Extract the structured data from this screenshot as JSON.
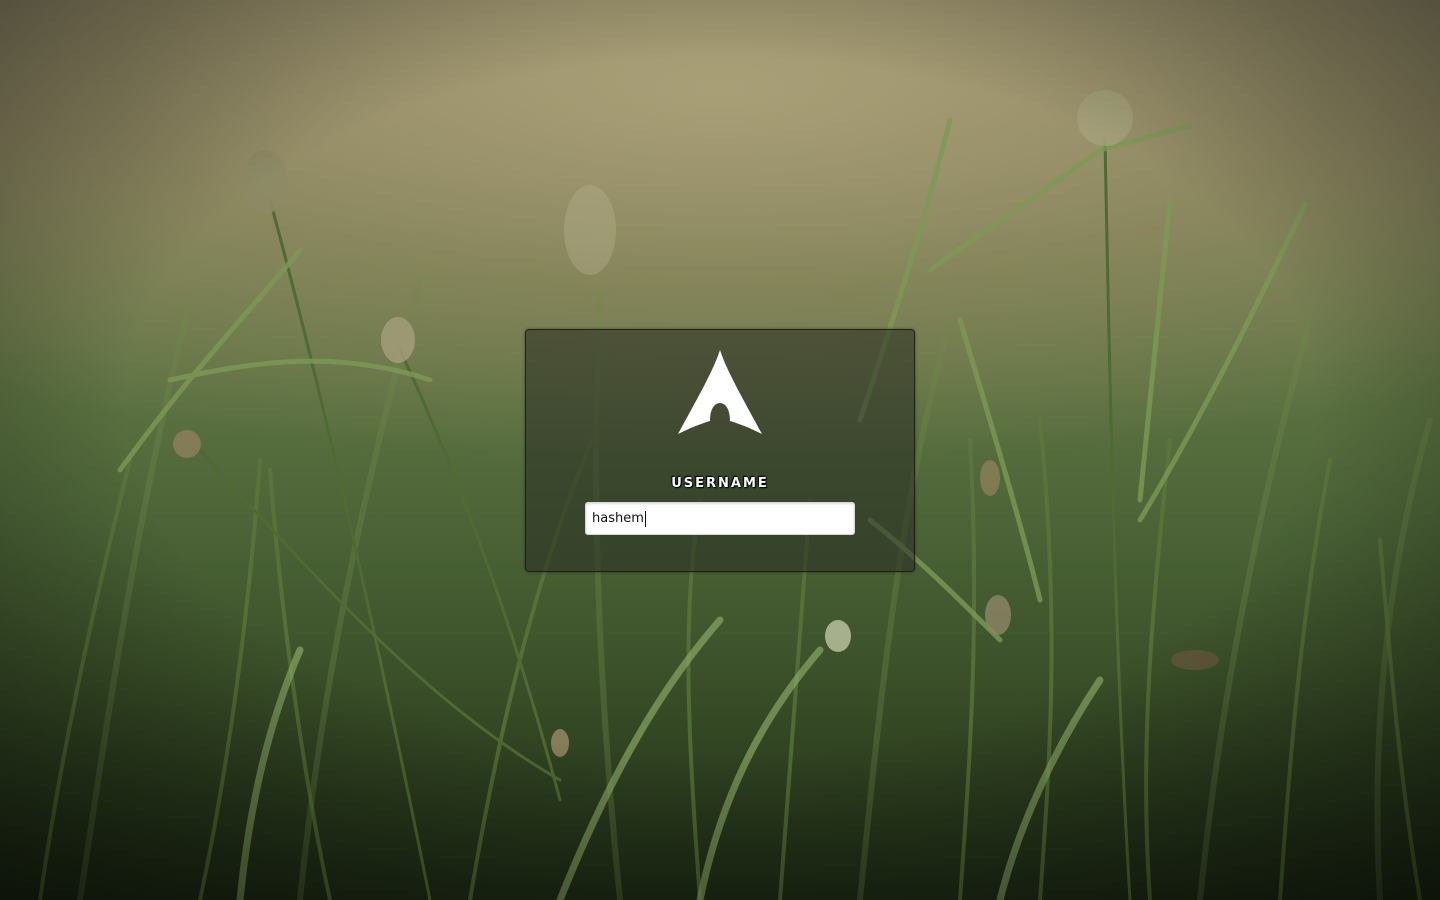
{
  "login": {
    "field_label": "USERNAME",
    "username_value": "hashem"
  },
  "icons": {
    "logo": "arch-linux-logo-icon"
  },
  "colors": {
    "panel_background": "#282c22",
    "logo": "#ffffff",
    "input_background": "#ffffff",
    "label_text": "#ffffff"
  }
}
